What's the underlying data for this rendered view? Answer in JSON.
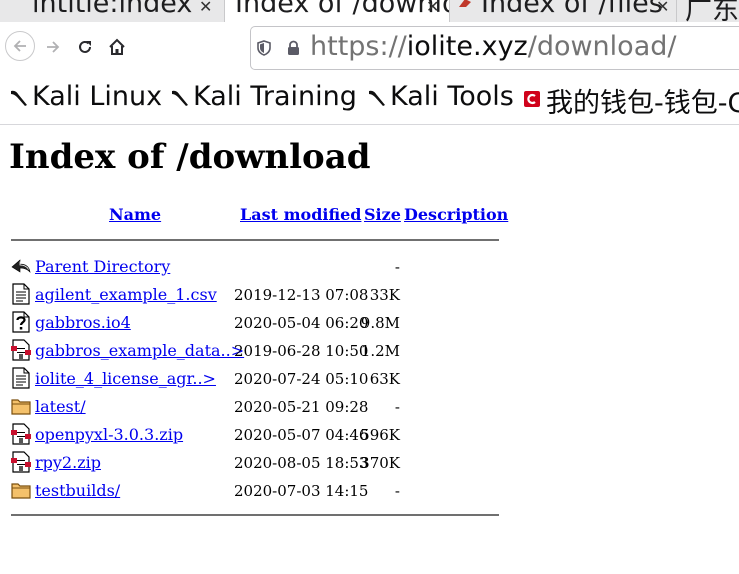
{
  "tabs": [
    {
      "title": "intitle:index",
      "close": "✕"
    },
    {
      "title": "Index of /download",
      "close": "✕"
    },
    {
      "title": "Index of /files",
      "close": "✕"
    },
    {
      "title": "广东"
    }
  ],
  "urlbar": {
    "scheme": "https://",
    "host": "iolite.xyz",
    "path": "/download/"
  },
  "bookmarks": [
    {
      "label": "Kali Linux",
      "icon": "kali-icon"
    },
    {
      "label": "Kali Training",
      "icon": "kali-icon"
    },
    {
      "label": "Kali Tools",
      "icon": "kali-icon"
    },
    {
      "label": "我的钱包-钱包-C",
      "icon": "wallet-icon"
    }
  ],
  "page": {
    "title": "Index of /download"
  },
  "listing": {
    "headers": {
      "name": "Name",
      "last_modified": "Last modified",
      "size": "Size",
      "description": "Description"
    },
    "rows": [
      {
        "icon": "back-arrow-icon",
        "name": "Parent Directory",
        "date": "",
        "size": "-"
      },
      {
        "icon": "text-file-icon",
        "name": "agilent_example_1.csv",
        "date": "2019-12-13 07:08",
        "size": "33K"
      },
      {
        "icon": "unknown-file-icon",
        "name": "gabbros.io4",
        "date": "2020-05-04 06:20",
        "size": "9.8M"
      },
      {
        "icon": "compressed-file-icon",
        "name": "gabbros_example_data..>",
        "date": "2019-06-28 10:50",
        "size": "1.2M"
      },
      {
        "icon": "text-file-icon",
        "name": "iolite_4_license_agr..>",
        "date": "2020-07-24 05:10",
        "size": "63K"
      },
      {
        "icon": "folder-icon",
        "name": "latest/",
        "date": "2020-05-21 09:28",
        "size": "-"
      },
      {
        "icon": "compressed-file-icon",
        "name": "openpyxl-3.0.3.zip",
        "date": "2020-05-07 04:46",
        "size": "596K"
      },
      {
        "icon": "compressed-file-icon",
        "name": "rpy2.zip",
        "date": "2020-08-05 18:53",
        "size": "370K"
      },
      {
        "icon": "folder-icon",
        "name": "testbuilds/",
        "date": "2020-07-03 14:15",
        "size": "-"
      }
    ]
  }
}
